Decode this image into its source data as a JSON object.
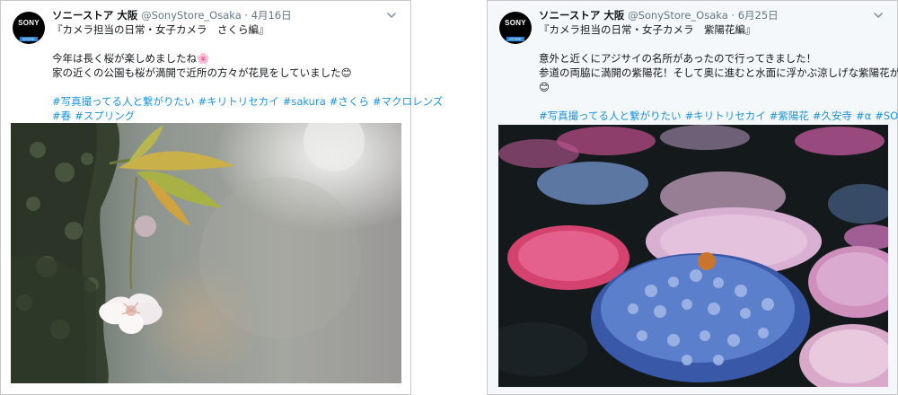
{
  "tweets": [
    {
      "account_name": "ソニーストア 大阪",
      "handle": "@SonyStore_Osaka",
      "separator": "·",
      "date": "4月16日",
      "avatar_text": "SONY",
      "avatar_sub": "STORE",
      "lines": [
        "『カメラ担当の日常・女子カメラ　さくら編』",
        "",
        "今年は長く桜が楽しめましたね🌸",
        "家の近くの公園も桜が満開で近所の方々が花見をしていました😊",
        ""
      ],
      "hashtag_lines": [
        [
          "#写真撮ってる人と繋がりたい",
          "#キリトリセカイ",
          "#sakura",
          "#さくら",
          "#マクロレンズ"
        ],
        [
          "#春",
          "#スプリング"
        ]
      ],
      "photo": "cherry-blossom-photo"
    },
    {
      "account_name": "ソニーストア 大阪",
      "handle": "@SonyStore_Osaka",
      "separator": "·",
      "date": "6月25日",
      "avatar_text": "SONY",
      "avatar_sub": "STORE",
      "lines": [
        "『カメラ担当の日常・女子カメラ　紫陽花編』",
        "",
        "意外と近くにアジサイの名所があったので行ってきました！",
        "参道の両脇に満開の紫陽花！そして奥に進むと水面に浮かぶ涼しげな紫陽花が",
        "😊",
        ""
      ],
      "hashtag_lines": [
        [
          "#写真撮ってる人と繋がりたい",
          "#キリトリセカイ",
          "#紫陽花",
          "#久安寺",
          "#α",
          "#SONY"
        ]
      ],
      "photo": "hydrangea-photo"
    }
  ],
  "colors": {
    "link": "#1b95e0",
    "secondary_text": "#657786",
    "primary_text": "#14171a",
    "card_border": "#c9c9c9"
  }
}
